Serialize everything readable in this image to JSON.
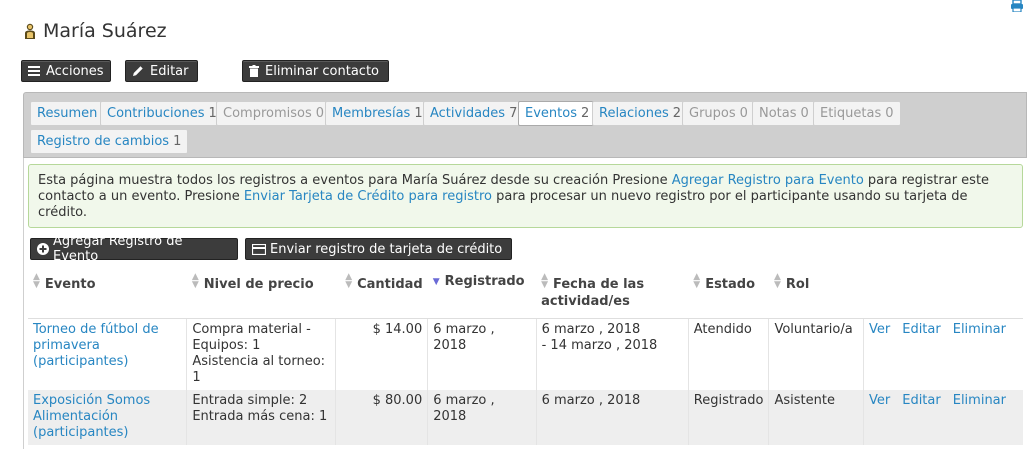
{
  "contact": {
    "name": "María Suárez"
  },
  "actions": {
    "acciones": "Acciones",
    "editar": "Editar",
    "eliminar": "Eliminar contacto"
  },
  "tabs": [
    {
      "label": "Resumen",
      "count": ""
    },
    {
      "label": "Contribuciones",
      "count": "1"
    },
    {
      "label": "Compromisos",
      "count": "0"
    },
    {
      "label": "Membresías",
      "count": "1"
    },
    {
      "label": "Actividades",
      "count": "7"
    },
    {
      "label": "Eventos",
      "count": "2"
    },
    {
      "label": "Relaciones",
      "count": "2"
    },
    {
      "label": "Grupos",
      "count": "0"
    },
    {
      "label": "Notas",
      "count": "0"
    },
    {
      "label": "Etiquetas",
      "count": "0"
    },
    {
      "label": "Registro de cambios",
      "count": "1"
    }
  ],
  "info": {
    "text1": "Esta página muestra todos los registros a eventos para María Suárez desde su creación Presione ",
    "link1": "Agregar Registro para Evento",
    "text2": " para registrar este contacto a un evento. Presione ",
    "link2": "Enviar Tarjeta de Crédito para registro",
    "text3": " para procesar un nuevo registro por el participante usando su tarjeta de crédito."
  },
  "buttons": {
    "add_event": "Agregar Registro de Evento",
    "send_card": "Enviar registro de tarjeta de crédito"
  },
  "table": {
    "headers": [
      "Evento",
      "Nivel de precio",
      "Cantidad",
      "Registrado",
      "Fecha de las",
      "actividad/es",
      "Estado",
      "Rol"
    ],
    "rows": [
      {
        "event": [
          "Torneo de fútbol de",
          "primavera",
          "(participantes)"
        ],
        "price": [
          "Compra material -",
          "Equipos: 1",
          "Asistencia al torneo:",
          "1"
        ],
        "amount": "$ 14.00",
        "registered": [
          "6 marzo ,",
          "2018"
        ],
        "dates": [
          "6 marzo , 2018",
          "- 14 marzo , 2018"
        ],
        "status": "Atendido",
        "role": "Voluntario/a",
        "links": [
          "Ver",
          "Editar",
          "Eliminar"
        ]
      },
      {
        "event": [
          "Exposición Somos",
          "Alimentación",
          "(participantes)"
        ],
        "price": [
          "Entrada simple: 2",
          "Entrada más cena: 1"
        ],
        "amount": "$ 80.00",
        "registered": [
          "6 marzo ,",
          "2018"
        ],
        "dates": [
          "6 marzo , 2018"
        ],
        "status": "Registrado",
        "role": "Asistente",
        "links": [
          "Ver",
          "Editar",
          "Eliminar"
        ]
      }
    ]
  }
}
